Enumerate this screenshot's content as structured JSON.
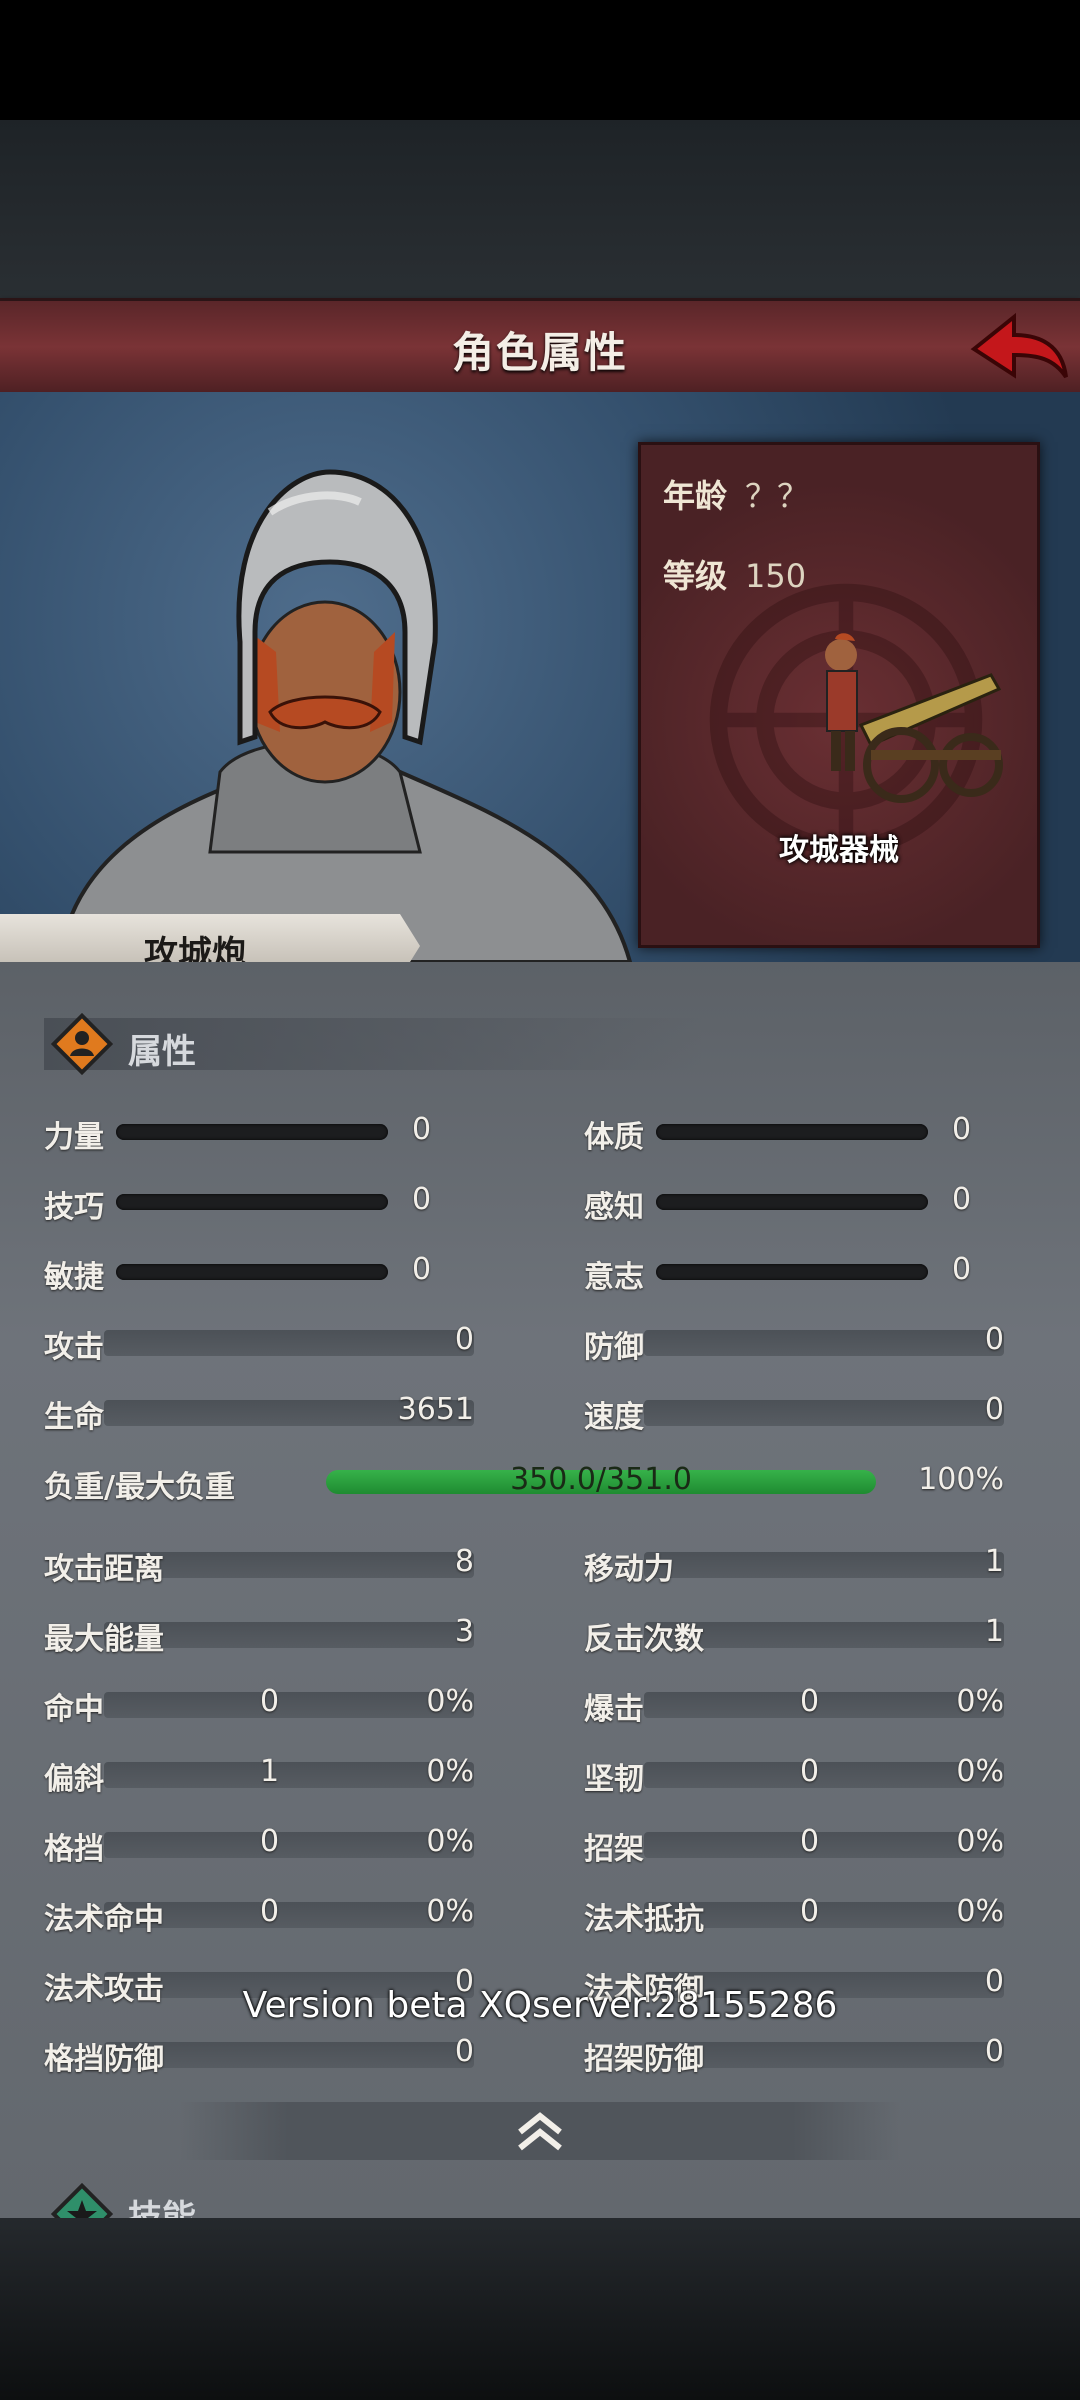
{
  "header": {
    "title": "角色属性"
  },
  "info_card": {
    "age_label": "年龄",
    "age_value": "？？",
    "level_label": "等级",
    "level_value": "150",
    "unit_type": "攻城器械"
  },
  "unit_name": "攻城炮",
  "attributes": {
    "section_title": "属性",
    "primary_left": [
      {
        "label": "力量",
        "value": "0"
      },
      {
        "label": "技巧",
        "value": "0"
      },
      {
        "label": "敏捷",
        "value": "0"
      }
    ],
    "primary_right": [
      {
        "label": "体质",
        "value": "0"
      },
      {
        "label": "感知",
        "value": "0"
      },
      {
        "label": "意志",
        "value": "0"
      }
    ],
    "combat_left": [
      {
        "label": "攻击",
        "value": "0"
      },
      {
        "label": "生命",
        "value": "3651"
      }
    ],
    "combat_right": [
      {
        "label": "防御",
        "value": "0"
      },
      {
        "label": "速度",
        "value": "0"
      }
    ],
    "load": {
      "label": "负重/最大负重",
      "value": "350.0/351.0",
      "percent": "100%"
    },
    "misc_left": [
      {
        "label": "攻击距离",
        "value": "8"
      },
      {
        "label": "最大能量",
        "value": "3"
      }
    ],
    "misc_right": [
      {
        "label": "移动力",
        "value": "1"
      },
      {
        "label": "反击次数",
        "value": "1"
      }
    ],
    "rate_left": [
      {
        "label": "命中",
        "value": "0",
        "pct": "0%"
      },
      {
        "label": "偏斜",
        "value": "1",
        "pct": "0%"
      },
      {
        "label": "格挡",
        "value": "0",
        "pct": "0%"
      },
      {
        "label": "法术命中",
        "value": "0",
        "pct": "0%"
      }
    ],
    "rate_right": [
      {
        "label": "爆击",
        "value": "0",
        "pct": "0%"
      },
      {
        "label": "坚韧",
        "value": "0",
        "pct": "0%"
      },
      {
        "label": "招架",
        "value": "0",
        "pct": "0%"
      },
      {
        "label": "法术抵抗",
        "value": "0",
        "pct": "0%"
      }
    ],
    "extra_left": [
      {
        "label": "法术攻击",
        "value": "0"
      },
      {
        "label": "格挡防御",
        "value": "0"
      }
    ],
    "extra_right": [
      {
        "label": "法术防御",
        "value": "0"
      },
      {
        "label": "招架防御",
        "value": "0"
      }
    ]
  },
  "skills": {
    "section_title": "技能"
  },
  "version_text": "Version beta XQserver.28155286"
}
